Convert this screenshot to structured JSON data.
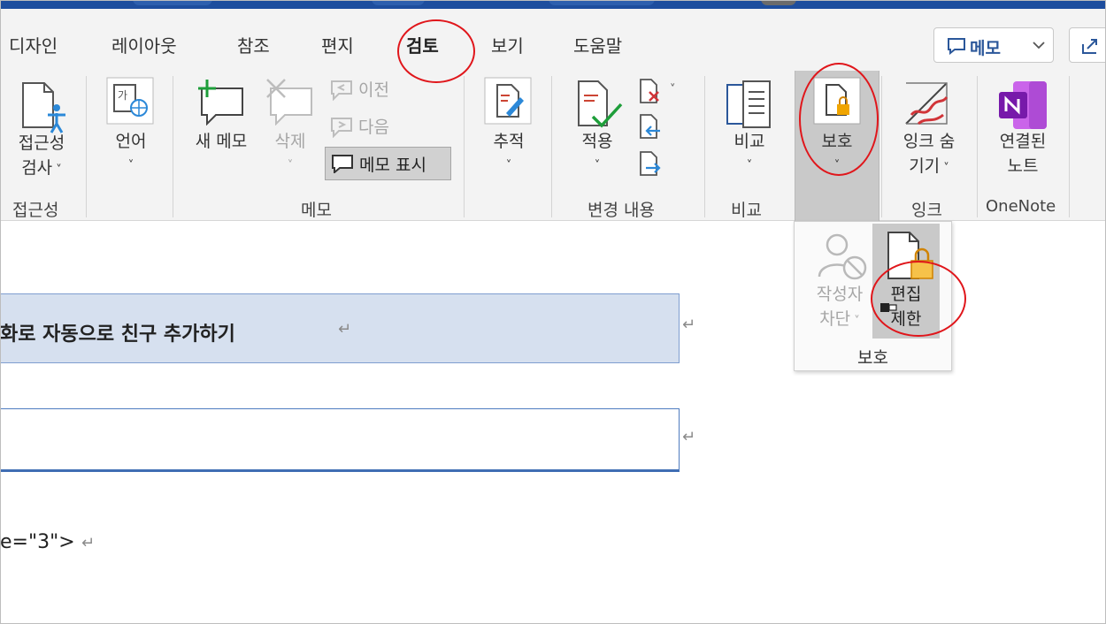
{
  "tabs": [
    {
      "label": "디자인",
      "active": false
    },
    {
      "label": "레이아웃",
      "active": false
    },
    {
      "label": "참조",
      "active": false
    },
    {
      "label": "편지",
      "active": false
    },
    {
      "label": "검토",
      "active": true
    },
    {
      "label": "보기",
      "active": false
    },
    {
      "label": "도움말",
      "active": false
    }
  ],
  "memo_button": {
    "label": "메모",
    "icon": "comment-icon"
  },
  "share_icon": "share-icon",
  "ribbon": {
    "accessibility": {
      "button_line1": "접근성",
      "button_line2": "검사",
      "group_label": "접근성"
    },
    "language": {
      "button": "언어"
    },
    "comments": {
      "new_comment": "새 메모",
      "delete": "삭제",
      "previous": "이전",
      "next": "다음",
      "show_comments": "메모 표시",
      "group_label": "메모"
    },
    "tracking": {
      "button": "추적"
    },
    "changes": {
      "accept": "적용",
      "group_label": "변경 내용"
    },
    "compare": {
      "button": "비교",
      "group_label": "비교"
    },
    "protect": {
      "button": "보호"
    },
    "ink": {
      "button_line1": "잉크 숨",
      "button_line2": "기기",
      "group_label": "잉크"
    },
    "onenote": {
      "button_line1": "연결된",
      "button_line2": "노트",
      "group_label": "OneNote"
    }
  },
  "protect_popup": {
    "block_authors_line1": "작성자",
    "block_authors_line2": "차단",
    "restrict_editing_line1": "편집",
    "restrict_editing_line2": "제한",
    "group_label": "보호"
  },
  "document": {
    "heading": "화로 자동으로 친구 추가하기",
    "code_line": "e=\"3\">",
    "return_mark": "↵"
  },
  "colors": {
    "accent": "#1e4e9e",
    "highlight_ring": "#e0161b",
    "heading_fill": "#d6e0ef",
    "onenote": "#7719aa"
  }
}
